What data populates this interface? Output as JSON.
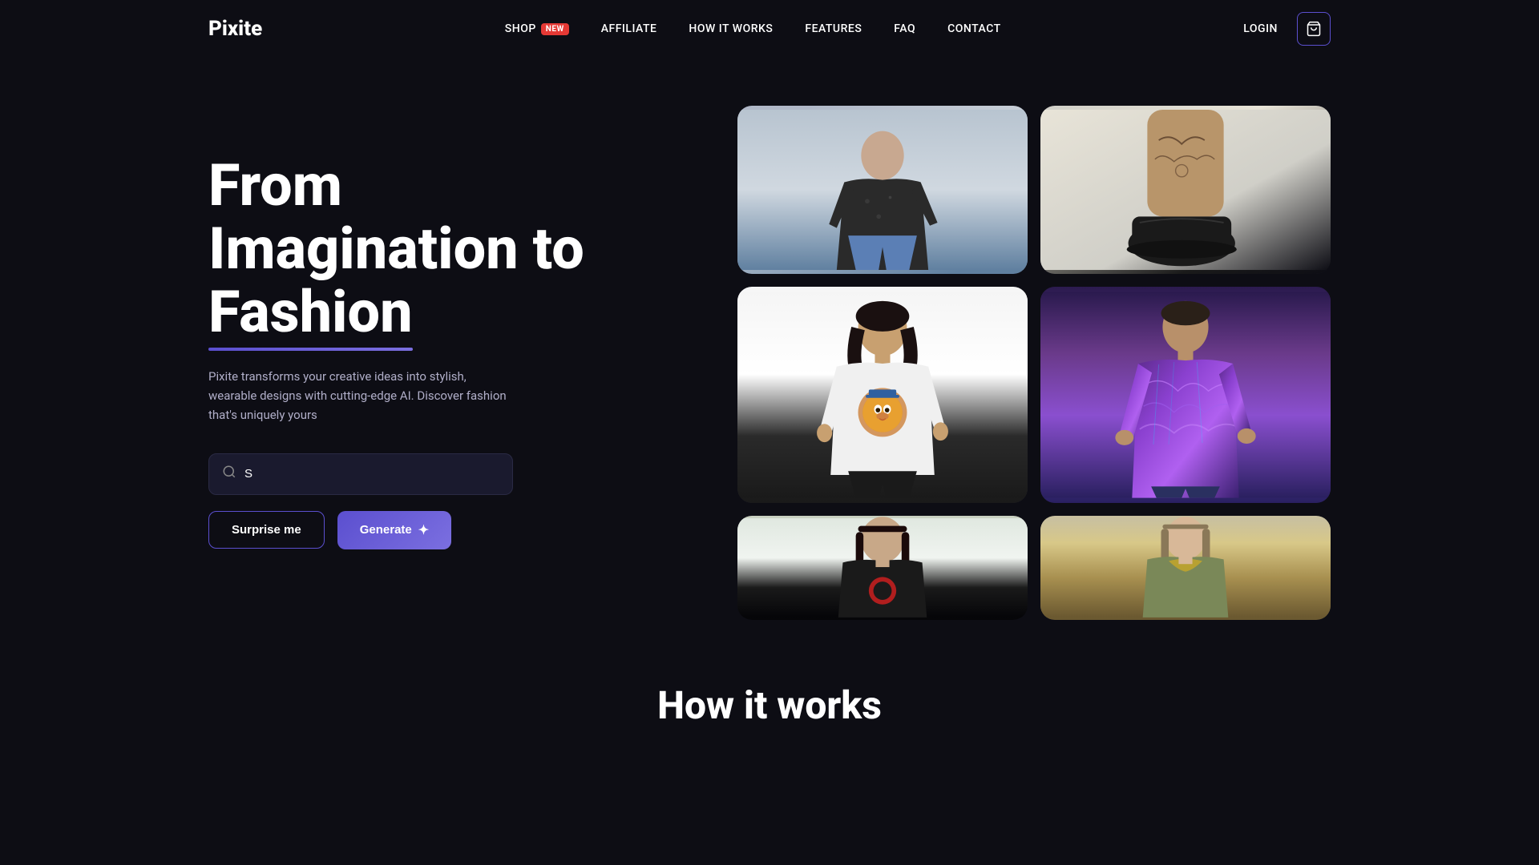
{
  "header": {
    "logo": "Pixite",
    "nav": [
      {
        "id": "shop",
        "label": "SHOP",
        "badge": "NEW"
      },
      {
        "id": "affiliate",
        "label": "AFFILIATE"
      },
      {
        "id": "how-it-works",
        "label": "HOW IT WORKS"
      },
      {
        "id": "features",
        "label": "FEATURES"
      },
      {
        "id": "faq",
        "label": "FAQ"
      },
      {
        "id": "contact",
        "label": "CONTACT"
      }
    ],
    "login_label": "LOGIN",
    "cart_icon": "cart-icon"
  },
  "hero": {
    "title_line1": "From",
    "title_line2": "Imagination to",
    "title_line3": "Fashion",
    "subtitle": "Pixite transforms your creative ideas into stylish, wearable designs with cutting-edge AI. Discover fashion that's uniquely yours",
    "search_placeholder": "S",
    "surprise_label": "Surprise me",
    "generate_label": "Generate"
  },
  "image_grid": {
    "cards": [
      {
        "id": "card-top-left",
        "alt": "Black floral shirt on model"
      },
      {
        "id": "card-top-right",
        "alt": "Tattooed shoe/foot"
      },
      {
        "id": "card-mid-left",
        "alt": "Woman in lion print tee"
      },
      {
        "id": "card-mid-right",
        "alt": "Man in purple abstract sweater"
      },
      {
        "id": "card-bot-left",
        "alt": "Woman in black graphic tee"
      },
      {
        "id": "card-bot-right",
        "alt": "Woman in gold collar sweater"
      }
    ]
  },
  "how_it_works": {
    "title": "How it works"
  },
  "colors": {
    "bg": "#0d0d14",
    "accent": "#5b4fcf",
    "badge_red": "#e53935"
  }
}
